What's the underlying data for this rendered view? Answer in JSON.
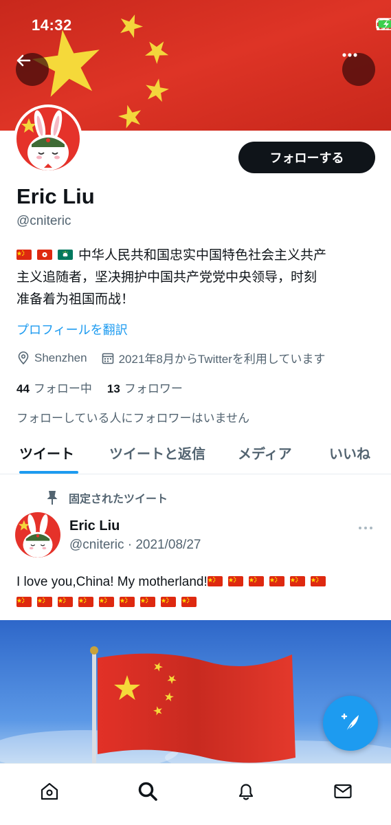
{
  "status_bar": {
    "time": "14:32"
  },
  "profile": {
    "display_name": "Eric Liu",
    "handle": "@cniteric",
    "follow_button": "フォローする",
    "bio_flags": [
      "cn-flag",
      "hk-flag",
      "mo-flag"
    ],
    "bio_line1": "中华人民共和国忠实中国特色社会主义共产",
    "bio_line2": "主义追随者，坚决拥护中国共产党党中央领导，时刻",
    "bio_line3": "准备着为祖国而战！",
    "translate_link": "プロフィールを翻訳",
    "location": "Shenzhen",
    "joined": "2021年8月からTwitterを利用しています",
    "following_count": "44",
    "following_label": "フォロー中",
    "followers_count": "13",
    "followers_label": "フォロワー",
    "followers_you_know": "フォローしている人にフォロワーはいません"
  },
  "tabs": [
    {
      "label": "ツイート",
      "active": true
    },
    {
      "label": "ツイートと返信",
      "active": false
    },
    {
      "label": "メディア",
      "active": false
    },
    {
      "label": "いいね",
      "active": false
    }
  ],
  "pinned_tweet": {
    "pinned_label": "固定されたツイート",
    "author_name": "Eric Liu",
    "author_meta": "@cniteric · 2021/08/27",
    "text": "I love you,China! My motherland!",
    "flag_count": 15
  },
  "bottom_nav": [
    "home-icon",
    "search-icon",
    "notifications-icon",
    "messages-icon"
  ],
  "colors": {
    "accent": "#1d9bf0",
    "banner_red": "#d92b1f",
    "text_primary": "#0f1419",
    "text_secondary": "#536471"
  }
}
